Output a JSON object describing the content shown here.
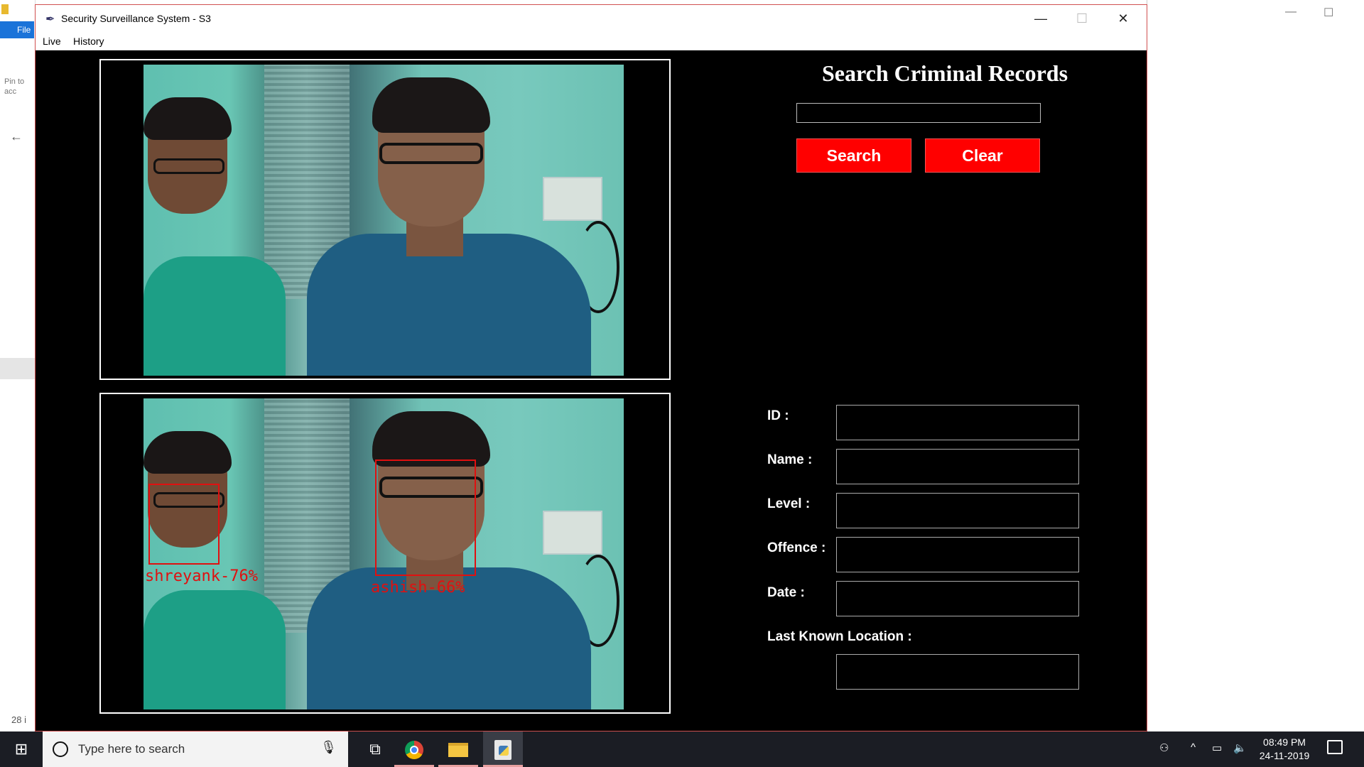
{
  "background_app": {
    "file_tab": "File",
    "pin_text": "Pin to acc",
    "count_text": "28 i"
  },
  "window": {
    "title": "Security Surveillance System - S3",
    "controls": {
      "minimize": "—",
      "maximize": "☐",
      "close": "✕"
    }
  },
  "menu": {
    "live": "Live",
    "history": "History"
  },
  "detections": [
    {
      "label": "shreyank-76%"
    },
    {
      "label": "ashish-66%"
    }
  ],
  "search_panel": {
    "title": "Search Criminal Records",
    "input_value": "",
    "search_button": "Search",
    "clear_button": "Clear"
  },
  "record_fields": {
    "id_label": "ID :",
    "id_value": "",
    "name_label": "Name :",
    "name_value": "",
    "level_label": "Level :",
    "level_value": "",
    "offence_label": "Offence :",
    "offence_value": "",
    "date_label": "Date :",
    "date_value": "",
    "location_label": "Last Known Location :",
    "location_value": ""
  },
  "taskbar": {
    "search_placeholder": "Type here to search",
    "time": "08:49 PM",
    "date": "24-11-2019"
  },
  "icons": {
    "start": "windows-icon",
    "search": "search-icon",
    "mic": "mic-icon",
    "task_view": "task-view-icon",
    "chrome": "chrome-icon",
    "explorer": "folder-icon",
    "python": "python-icon"
  },
  "colors": {
    "accent_button": "#ff0000",
    "window_bg": "#000000",
    "detection_box": "#e01010",
    "taskbar_bg": "#1b1d24"
  }
}
